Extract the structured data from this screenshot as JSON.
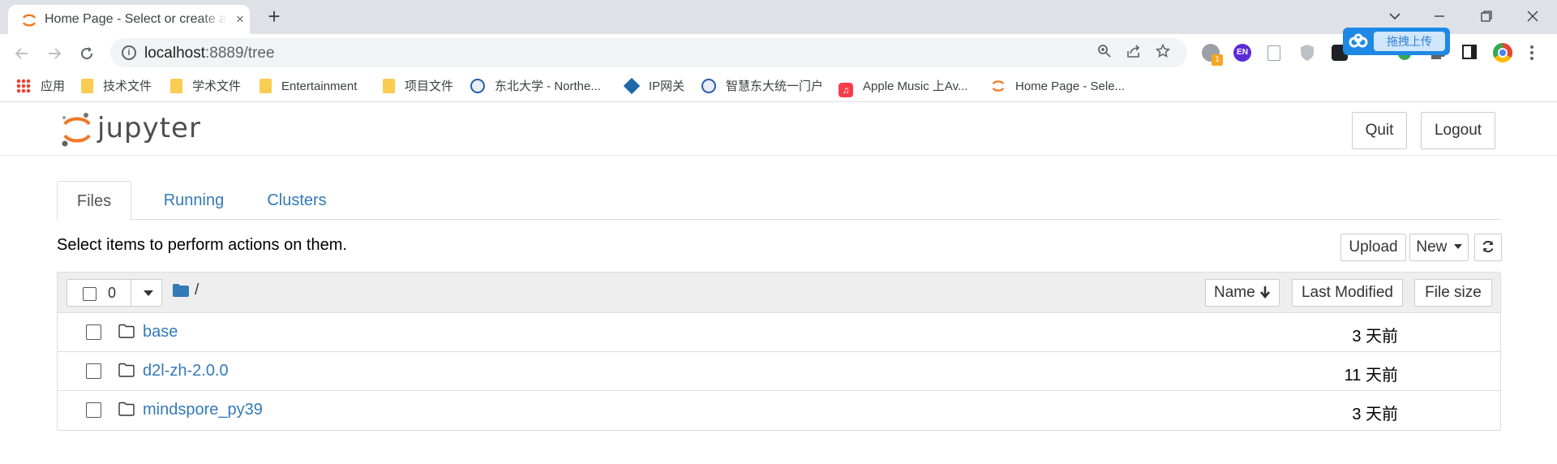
{
  "browser": {
    "tab": {
      "title": "Home Page - Select or create a notebook",
      "close": "×",
      "favicon": "jupyter-favicon"
    },
    "new_tab": "+",
    "window": {
      "minimize": "—",
      "restore": "❐",
      "close": "✕",
      "tabs_menu": "⌄"
    },
    "address": {
      "url_host": "localhost",
      "url_rest": ":8889/tree"
    },
    "baidu_popup": {
      "label": "拖拽上传"
    },
    "extension_badge": "1",
    "extension_en": "EN"
  },
  "bookmarks": [
    {
      "label": "应用",
      "icon": "apps-grid-icon"
    },
    {
      "label": "技术文件",
      "icon": "folder-icon"
    },
    {
      "label": "学术文件",
      "icon": "folder-icon"
    },
    {
      "label": "Entertainment",
      "icon": "folder-icon"
    },
    {
      "label": "项目文件",
      "icon": "folder-icon"
    },
    {
      "label": "东北大学 - Northe...",
      "icon": "university-icon"
    },
    {
      "label": "IP网关",
      "icon": "gateway-icon"
    },
    {
      "label": "智慧东大统一门户",
      "icon": "university-icon"
    },
    {
      "label": "Apple Music 上Av...",
      "icon": "music-icon"
    },
    {
      "label": "Home Page - Sele...",
      "icon": "jupyter-favicon"
    }
  ],
  "jupyter": {
    "logo_text": "jupyter",
    "quit_label": "Quit",
    "logout_label": "Logout",
    "tabs": [
      {
        "label": "Files",
        "active": true
      },
      {
        "label": "Running",
        "active": false
      },
      {
        "label": "Clusters",
        "active": false
      }
    ],
    "hint": "Select items to perform actions on them.",
    "upload_label": "Upload",
    "new_label": "New",
    "refresh_icon": "↻",
    "selected_count": "0",
    "breadcrumb_path": "/",
    "columns": {
      "name": "Name",
      "sort_arrow": "🡣",
      "last_modified": "Last Modified",
      "file_size": "File size"
    },
    "files": [
      {
        "name": "base",
        "modified": "3 天前",
        "type": "folder"
      },
      {
        "name": "d2l-zh-2.0.0",
        "modified": "11 天前",
        "type": "folder"
      },
      {
        "name": "mindspore_py39",
        "modified": "3 天前",
        "type": "folder"
      }
    ]
  },
  "colors": {
    "jupyter_orange": "#f37726",
    "link_blue": "#337ab7",
    "chrome_tabstrip": "#dee1e6"
  }
}
